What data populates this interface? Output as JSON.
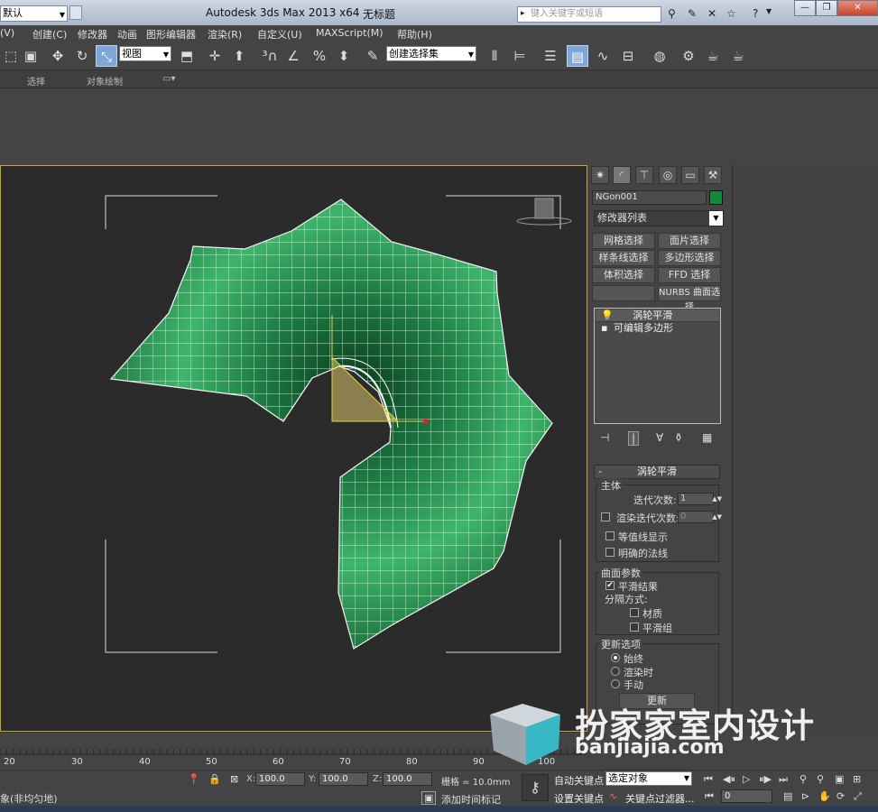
{
  "titlebar": {
    "workspace": "默认",
    "app_title": "Autodesk 3ds Max  2013 x64",
    "doc_title": "无标题",
    "search_placeholder": "键入关键字或短语"
  },
  "menu": [
    "(V)",
    "创建(C)",
    "修改器",
    "动画",
    "图形编辑器",
    "渲染(R)",
    "自定义(U)",
    "MAXScript(M)",
    "帮助(H)"
  ],
  "toolbar": {
    "view_combo": "视图",
    "selection_set": "创建选择集"
  },
  "ribbon": {
    "tab1": "选择",
    "tab2": "对象绘制"
  },
  "panel": {
    "object_name": "NGon001",
    "object_color": "#138a3b",
    "modifier_list": "修改器列表",
    "buttons": [
      "网格选择",
      "面片选择",
      "样条线选择",
      "多边形选择",
      "体积选择",
      "FFD 选择",
      "",
      "NURBS 曲面选择"
    ],
    "stack": [
      "涡轮平滑",
      "可编辑多边形"
    ],
    "rollout_title": "涡轮平滑",
    "main_group": "主体",
    "iterations_label": "迭代次数:",
    "iterations_value": "1",
    "render_iter_label": "渲染迭代次数:",
    "render_iter_value": "0",
    "isoline_label": "等值线显示",
    "explicit_normals_label": "明确的法线",
    "surface_group": "曲面参数",
    "smooth_result_label": "平滑结果",
    "separate_by_label": "分隔方式:",
    "material_label": "材质",
    "smoothing_group_label": "平滑组",
    "update_group": "更新选项",
    "always_label": "始终",
    "when_render_label": "渲染时",
    "manual_label": "手动",
    "update_button": "更新"
  },
  "timeline": {
    "ticks": [
      "20",
      "30",
      "40",
      "50",
      "60",
      "70",
      "80",
      "90",
      "100"
    ]
  },
  "status": {
    "x_label": "X:",
    "x_value": "100.0",
    "y_label": "Y:",
    "y_value": "100.0",
    "z_label": "Z:",
    "z_value": "100.0",
    "grid": "栅格 = 10.0mm",
    "prompt": "象(非均匀地)",
    "add_time_tag": "添加时间标记",
    "auto_key": "自动关键点",
    "set_key": "设置关键点",
    "selected_object": "选定对象",
    "key_filters": "关键点过滤器...",
    "frame": "0"
  },
  "watermark": {
    "text": "扮家家室内设计",
    "url": "banjiajia.com"
  }
}
